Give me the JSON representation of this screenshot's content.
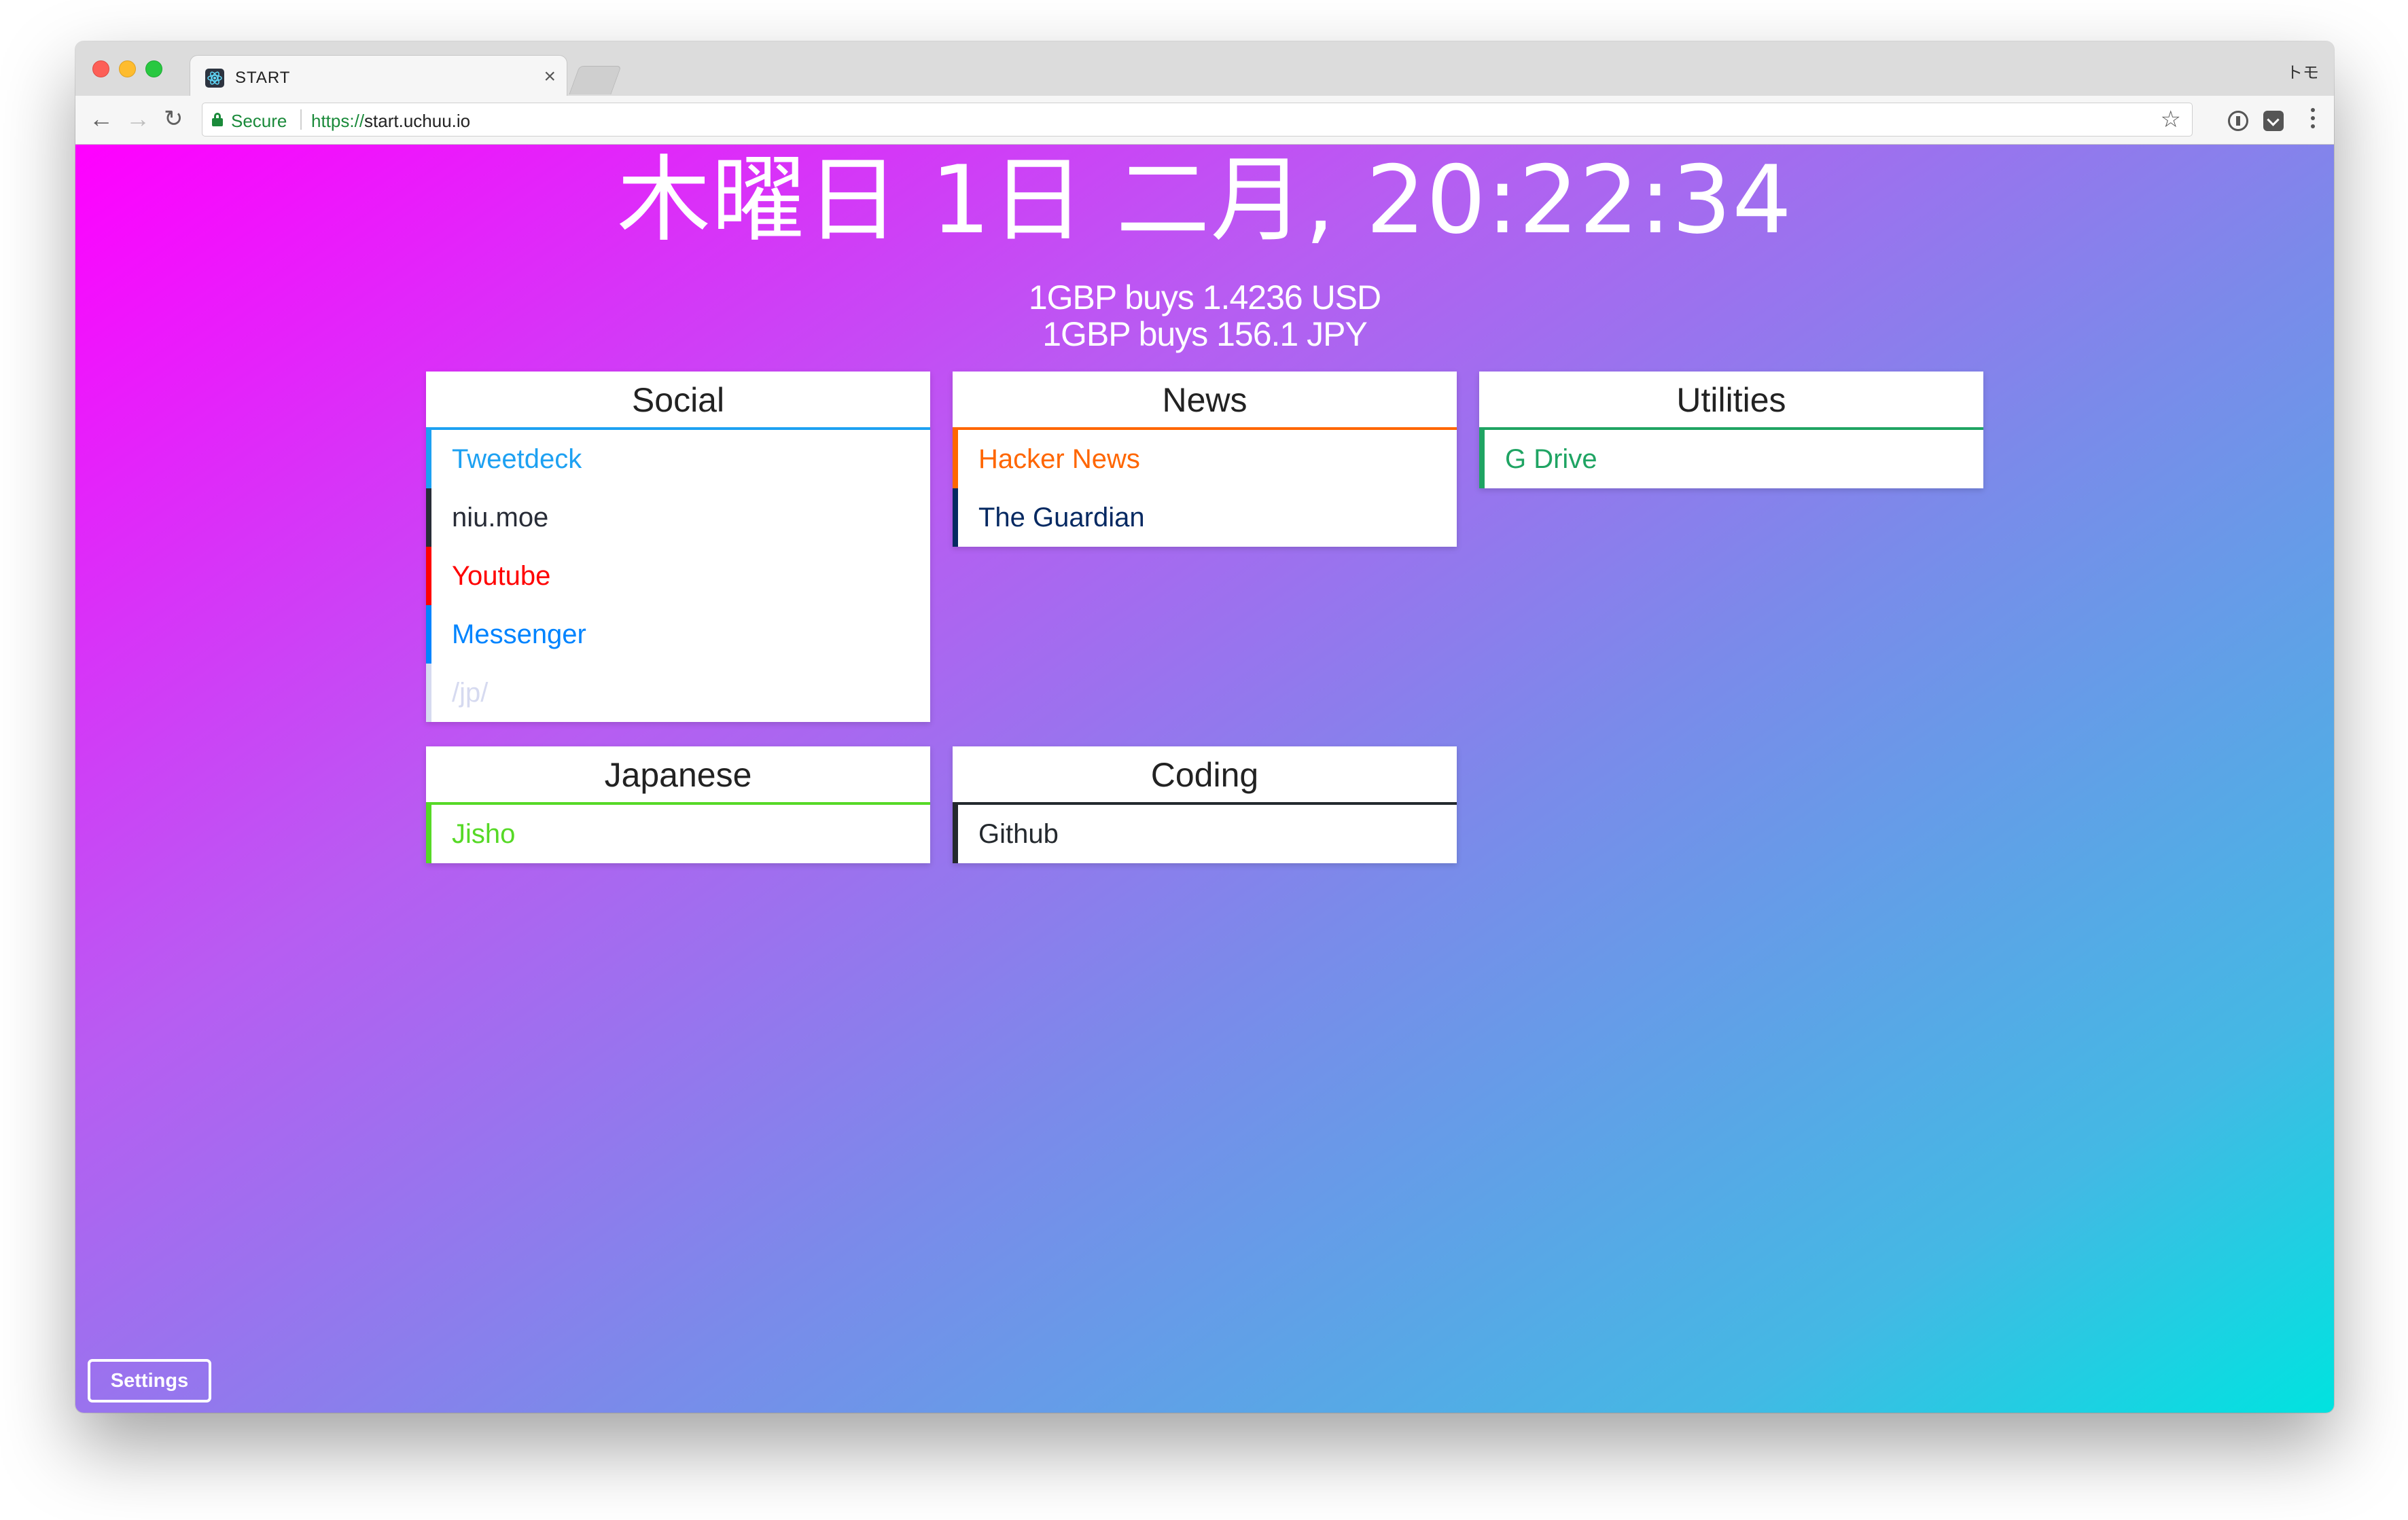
{
  "browser": {
    "tab_title": "START",
    "tab_close": "×",
    "profile_label": "トモ",
    "secure_label": "Secure",
    "url_scheme": "https://",
    "url_host": "start.uchuu.io",
    "back_icon": "←",
    "forward_icon": "→",
    "reload_icon": "↻",
    "star_icon": "☆"
  },
  "header": {
    "clock": "木曜日 1日 二月, 20:22:34",
    "rate_usd": "1GBP buys 1.4236 USD",
    "rate_jpy": "1GBP buys 156.1 JPY"
  },
  "groups": [
    {
      "title": "Social",
      "accent": "#1da1f2",
      "links": [
        {
          "label": "Tweetdeck",
          "color": "#1da1f2"
        },
        {
          "label": "niu.moe",
          "color": "#282c37"
        },
        {
          "label": "Youtube",
          "color": "#ff0000"
        },
        {
          "label": "Messenger",
          "color": "#0084ff"
        },
        {
          "label": "/jp/",
          "color": "#d6daf0"
        }
      ]
    },
    {
      "title": "News",
      "accent": "#ff6600",
      "links": [
        {
          "label": "Hacker News",
          "color": "#ff6600"
        },
        {
          "label": "The Guardian",
          "color": "#052962"
        }
      ]
    },
    {
      "title": "Utilities",
      "accent": "#1fa463",
      "links": [
        {
          "label": "G Drive",
          "color": "#1fa463"
        }
      ]
    },
    {
      "title": "Japanese",
      "accent": "#56d926",
      "links": [
        {
          "label": "Jisho",
          "color": "#56d926"
        }
      ]
    },
    {
      "title": "Coding",
      "accent": "#24292e",
      "links": [
        {
          "label": "Github",
          "color": "#24292e"
        }
      ]
    }
  ],
  "settings": {
    "label": "Settings"
  }
}
